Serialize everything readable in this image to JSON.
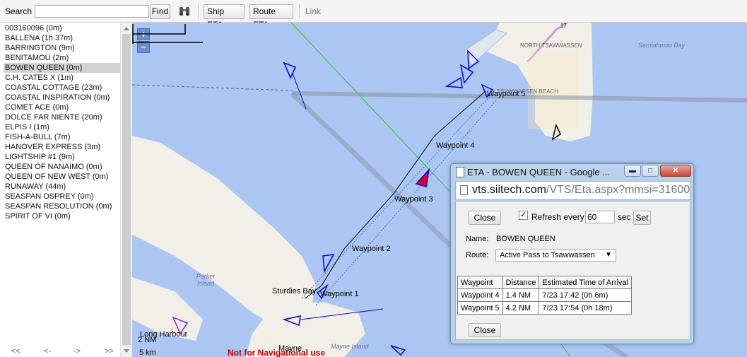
{
  "toolbar": {
    "search_label": "Search",
    "search_value": "",
    "find_label": "Find",
    "ship_eta_label": "Ship ETA",
    "route_eta_label": "Route ETA",
    "link_label": "Link",
    "binoculars_icon": "binoculars-icon"
  },
  "sidebar": {
    "ships": [
      "003160096 (0m)",
      "BALLENA (1h 37m)",
      "BARRINGTON (9m)",
      "BENITAMOU (2m)",
      "BOWEN QUEEN (0m)",
      "C.H. CATES X (1m)",
      "COASTAL COTTAGE (23m)",
      "COASTAL INSPIRATION (0m)",
      "COMET ACE (0m)",
      "DOLCE FAR NIENTE (20m)",
      "ELPIS I (1m)",
      "FISH-A-BULL (7m)",
      "HANOVER EXPRESS (3m)",
      "LIGHTSHIP #1 (9m)",
      "QUEEN OF NANAIMO (0m)",
      "QUEEN OF NEW WEST (0m)",
      "RUNAWAY (44m)",
      "SEASPAN OSPREY (0m)",
      "SEASPAN RESOLUTION (0m)",
      "SPIRIT OF VI (0m)"
    ],
    "selected_ship": "BOWEN QUEEN (0m)",
    "pager": {
      "first": "<<",
      "prev": "<-",
      "next": "->",
      "last": ">>"
    }
  },
  "map": {
    "zoom_in": "+",
    "zoom_out": "−",
    "waypoints": [
      "Waypoint 1",
      "Waypoint 2",
      "Waypoint 3",
      "Waypoint 4",
      "Waypoint 5"
    ],
    "places": {
      "north_tsawwassen": "NORTH TSAWWASSEN",
      "tsawwassen_beach": "TSAWWASSEN BEACH",
      "semiahmoo_bay": "Semiahmoo Bay",
      "parker_island": "Parker Island",
      "sturdies_bay": "Sturdies Bay",
      "long_harbour": "Long Harbour",
      "mayne": "Mayne",
      "mayne_island": "Mayne Island",
      "highway_shield": "17"
    },
    "scale_nm": "2 NM",
    "scale_km": "5 km",
    "warning": "Not for Navigational use",
    "colors": {
      "water": "#abc6f2",
      "land": "#f2efe8",
      "vessel": "#0000ee",
      "route": "#000000"
    }
  },
  "dialog": {
    "title": "ETA - BOWEN QUEEN - Google ...",
    "address_host": "vts.siitech.com",
    "address_path": "/VTS/Eta.aspx?mmsi=31600",
    "close_label": "Close",
    "refresh_checked": true,
    "refresh_label": "Refresh every",
    "refresh_value": "60",
    "sec_label": "sec",
    "set_label": "Set",
    "name_label": "Name:",
    "name_value": "BOWEN QUEEN",
    "route_label": "Route:",
    "route_value": "Active Pass to Tsawwassen",
    "table": {
      "headers": [
        "Waypoint",
        "Distance",
        "Estimated Time of Arrival"
      ],
      "rows": [
        [
          "Waypoint 4",
          "1.4 NM",
          "7/23 17:42 (0h 6m)"
        ],
        [
          "Waypoint 5",
          "4.2 NM",
          "7/23 17:54 (0h 18m)"
        ]
      ]
    }
  }
}
